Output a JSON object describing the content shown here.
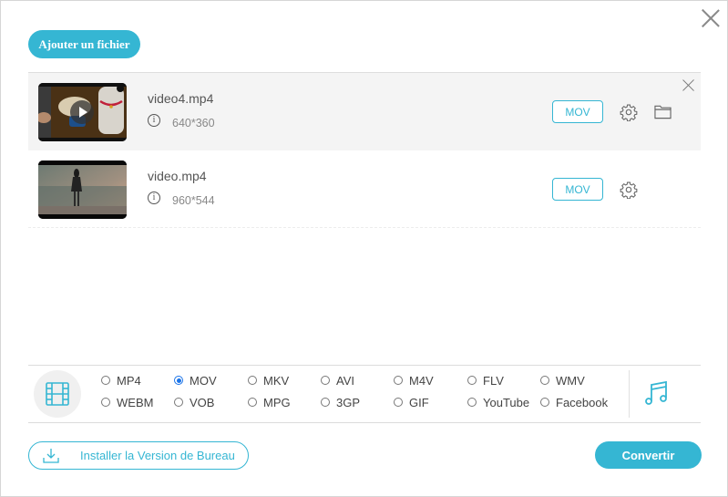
{
  "header": {
    "add_file_label": "Ajouter un fichier",
    "close_icon": "close-icon"
  },
  "files": [
    {
      "name": "video4.mp4",
      "resolution": "640*360",
      "output_format": "MOV",
      "thumbnail": "cartoon-scene-with-play-overlay",
      "has_folder_icon": true,
      "has_remove_icon": true,
      "highlighted": true
    },
    {
      "name": "video.mp4",
      "resolution": "960*544",
      "output_format": "MOV",
      "thumbnail": "person-standing-landscape",
      "has_folder_icon": false,
      "has_remove_icon": false,
      "highlighted": false
    }
  ],
  "formats": {
    "video_icon": "film-icon",
    "audio_icon": "music-note-icon",
    "selected": "MOV",
    "row1": [
      "MP4",
      "MOV",
      "MKV",
      "AVI",
      "M4V",
      "FLV",
      "WMV"
    ],
    "row2": [
      "WEBM",
      "VOB",
      "MPG",
      "3GP",
      "GIF",
      "YouTube",
      "Facebook"
    ]
  },
  "footer": {
    "install_label": "Installer la Version de Bureau",
    "convert_label": "Convertir"
  },
  "colors": {
    "accent": "#35b6d3",
    "radio_selected": "#1a73e8"
  }
}
